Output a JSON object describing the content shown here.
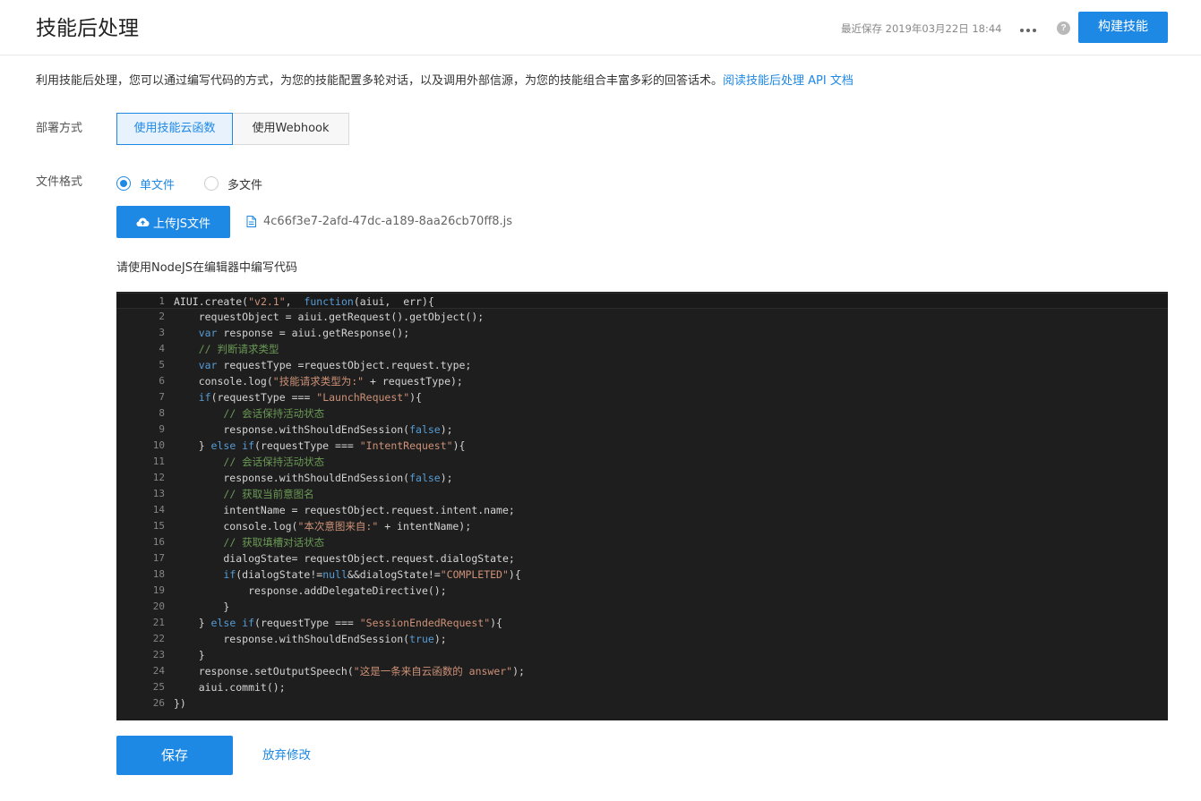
{
  "header": {
    "title": "技能后处理",
    "save_time": "最近保存 2019年03月22日 18:44",
    "help_label": "?",
    "build_button": "构建技能"
  },
  "description": {
    "text": "利用技能后处理，您可以通过编写代码的方式，为您的技能配置多轮对话，以及调用外部信源，为您的技能组合丰富多彩的回答话术。",
    "link": "阅读技能后处理 API 文档"
  },
  "deploy": {
    "label": "部署方式",
    "options": [
      "使用技能云函数",
      "使用Webhook"
    ],
    "selected": "使用技能云函数"
  },
  "file_format": {
    "label": "文件格式",
    "options": [
      "单文件",
      "多文件"
    ],
    "selected": "单文件"
  },
  "upload": {
    "button": "上传JS文件",
    "filename": "4c66f3e7-2afd-47dc-a189-8aa26cb70ff8.js"
  },
  "editor": {
    "hint": "请使用NodeJS在编辑器中编写代码",
    "lines": [
      [
        {
          "t": "AIUI.create("
        },
        {
          "t": "\"v2.1\"",
          "c": "str"
        },
        {
          "t": ",  "
        },
        {
          "t": "function",
          "c": "kw"
        },
        {
          "t": "(aiui,  err){"
        }
      ],
      [
        {
          "t": "    requestObject = aiui.getRequest().getObject();"
        }
      ],
      [
        {
          "t": "    "
        },
        {
          "t": "var",
          "c": "kw"
        },
        {
          "t": " response = aiui.getResponse();"
        }
      ],
      [
        {
          "t": "    "
        },
        {
          "t": "// 判断请求类型",
          "c": "com"
        }
      ],
      [
        {
          "t": "    "
        },
        {
          "t": "var",
          "c": "kw"
        },
        {
          "t": " requestType =requestObject.request.type;"
        }
      ],
      [
        {
          "t": "    console.log("
        },
        {
          "t": "\"技能请求类型为:\"",
          "c": "str"
        },
        {
          "t": " + requestType);"
        }
      ],
      [
        {
          "t": "    "
        },
        {
          "t": "if",
          "c": "kw"
        },
        {
          "t": "(requestType === "
        },
        {
          "t": "\"LaunchRequest\"",
          "c": "str"
        },
        {
          "t": "){"
        }
      ],
      [
        {
          "t": "        "
        },
        {
          "t": "// 会话保持活动状态",
          "c": "com"
        }
      ],
      [
        {
          "t": "        response.withShouldEndSession("
        },
        {
          "t": "false",
          "c": "kw"
        },
        {
          "t": ");"
        }
      ],
      [
        {
          "t": "    } "
        },
        {
          "t": "else if",
          "c": "kw"
        },
        {
          "t": "(requestType === "
        },
        {
          "t": "\"IntentRequest\"",
          "c": "str"
        },
        {
          "t": "){"
        }
      ],
      [
        {
          "t": "        "
        },
        {
          "t": "// 会话保持活动状态",
          "c": "com"
        }
      ],
      [
        {
          "t": "        response.withShouldEndSession("
        },
        {
          "t": "false",
          "c": "kw"
        },
        {
          "t": ");"
        }
      ],
      [
        {
          "t": "        "
        },
        {
          "t": "// 获取当前意图名",
          "c": "com"
        }
      ],
      [
        {
          "t": "        intentName = requestObject.request.intent.name;"
        }
      ],
      [
        {
          "t": "        console.log("
        },
        {
          "t": "\"本次意图来自:\"",
          "c": "str"
        },
        {
          "t": " + intentName);"
        }
      ],
      [
        {
          "t": "        "
        },
        {
          "t": "// 获取填槽对话状态",
          "c": "com"
        }
      ],
      [
        {
          "t": "        dialogState= requestObject.request.dialogState;"
        }
      ],
      [
        {
          "t": "        "
        },
        {
          "t": "if",
          "c": "kw"
        },
        {
          "t": "(dialogState!="
        },
        {
          "t": "null",
          "c": "kw"
        },
        {
          "t": "&&dialogState!="
        },
        {
          "t": "\"COMPLETED\"",
          "c": "str"
        },
        {
          "t": "){"
        }
      ],
      [
        {
          "t": "            response.addDelegateDirective();"
        }
      ],
      [
        {
          "t": "        }"
        }
      ],
      [
        {
          "t": "    } "
        },
        {
          "t": "else if",
          "c": "kw"
        },
        {
          "t": "(requestType === "
        },
        {
          "t": "\"SessionEndedRequest\"",
          "c": "str"
        },
        {
          "t": "){"
        }
      ],
      [
        {
          "t": "        response.withShouldEndSession("
        },
        {
          "t": "true",
          "c": "kw"
        },
        {
          "t": ");"
        }
      ],
      [
        {
          "t": "    }"
        }
      ],
      [
        {
          "t": "    response.setOutputSpeech("
        },
        {
          "t": "\"这是一条来自云函数的 answer\"",
          "c": "str"
        },
        {
          "t": ");"
        }
      ],
      [
        {
          "t": "    aiui.commit();"
        }
      ],
      [
        {
          "t": "})"
        }
      ]
    ]
  },
  "actions": {
    "save": "保存",
    "discard": "放弃修改"
  }
}
